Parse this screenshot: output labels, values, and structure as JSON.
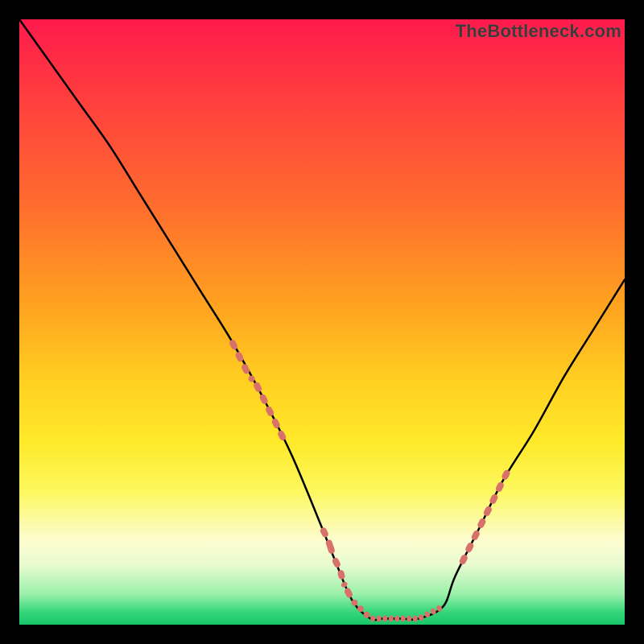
{
  "watermark": "TheBottleneck.com",
  "chart_data": {
    "type": "line",
    "title": "",
    "xlabel": "",
    "ylabel": "",
    "xlim": [
      0,
      100
    ],
    "ylim": [
      0,
      100
    ],
    "series": [
      {
        "name": "bottleneck-curve",
        "x": [
          0,
          5,
          10,
          15,
          20,
          25,
          30,
          35,
          40,
          45,
          50,
          52,
          55,
          58,
          60,
          63,
          66,
          70,
          72,
          76,
          80,
          85,
          90,
          95,
          100
        ],
        "y": [
          100,
          93,
          86,
          79,
          71,
          63,
          55,
          47,
          38,
          28,
          16,
          11,
          4,
          1,
          1,
          1,
          1,
          3,
          8,
          16,
          24,
          32,
          41,
          49,
          57
        ]
      }
    ],
    "markers": {
      "name": "highlight-segments",
      "color": "#d9716b",
      "segments": [
        {
          "x": [
            35,
            36,
            37,
            38,
            39,
            40,
            41,
            42,
            43,
            44
          ],
          "y": [
            47,
            45,
            43,
            41,
            40,
            38,
            36,
            34,
            32,
            30
          ]
        },
        {
          "x": [
            50,
            51,
            52,
            53,
            53.5,
            54,
            55,
            56,
            57,
            58,
            59,
            60,
            61,
            62,
            63,
            64,
            65,
            66,
            67,
            68,
            69,
            70
          ],
          "y": [
            16,
            14,
            11,
            9,
            7,
            6,
            4,
            3,
            2,
            1,
            1,
            1,
            1,
            1,
            1,
            1,
            1,
            1,
            1.5,
            2,
            2.5,
            3
          ]
        },
        {
          "x": [
            73,
            74,
            75,
            76,
            77,
            78,
            79,
            80,
            81
          ],
          "y": [
            10,
            12,
            14,
            16,
            18,
            20,
            22,
            24,
            26
          ]
        }
      ]
    }
  }
}
